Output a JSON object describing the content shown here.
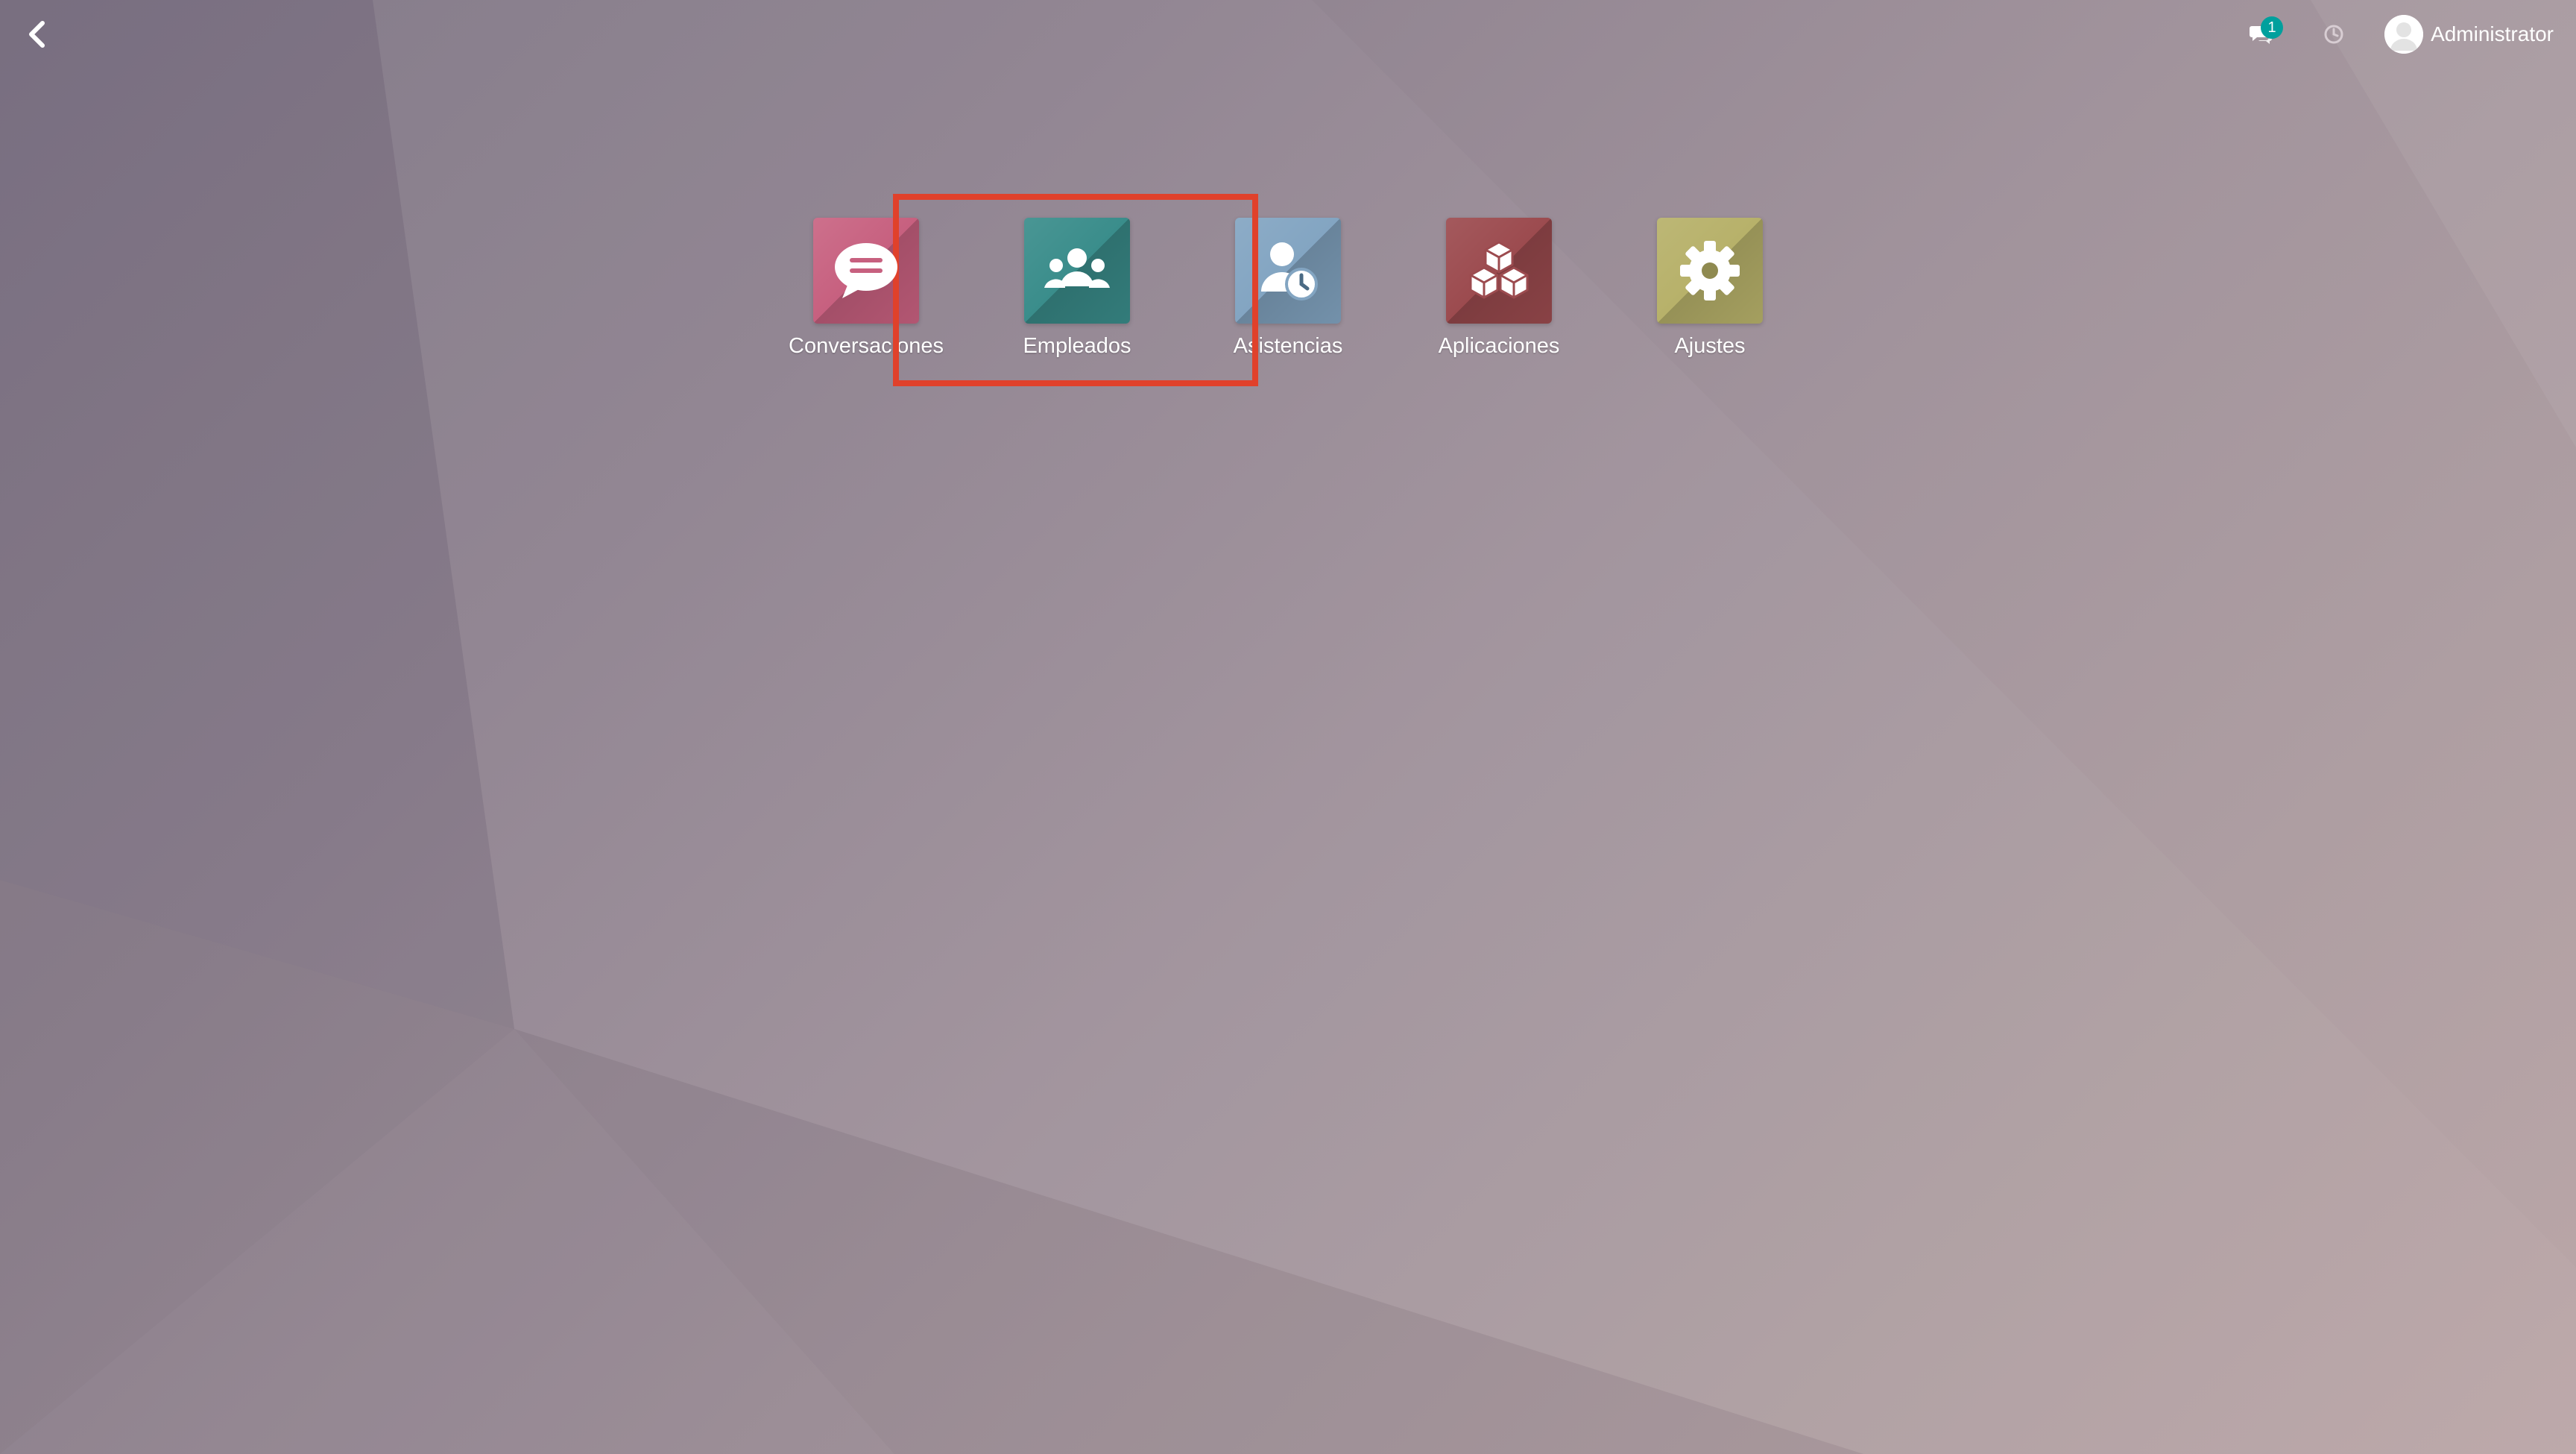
{
  "topbar": {
    "back_icon": "chevron-left-icon",
    "chat_icon": "chat-bubbles-icon",
    "chat_badge": "1",
    "clock_icon": "clock-icon",
    "user_name": "Administrator",
    "avatar_icon": "user-avatar-icon"
  },
  "apps": [
    {
      "label": "Conversaciones",
      "icon": "speech-bubble-icon",
      "color": "#c7607f"
    },
    {
      "label": "Empleados",
      "icon": "people-group-icon",
      "color": "#3a8d8b"
    },
    {
      "label": "Asistencias",
      "icon": "user-clock-icon",
      "color": "#83a5c2"
    },
    {
      "label": "Aplicaciones",
      "icon": "cubes-icon",
      "color": "#9c4b4f"
    },
    {
      "label": "Ajustes",
      "icon": "gear-icon",
      "color": "#b7b16a"
    }
  ],
  "annotation": {
    "color": "#e0412b",
    "highlighted_apps": [
      "Empleados",
      "Asistencias"
    ]
  }
}
